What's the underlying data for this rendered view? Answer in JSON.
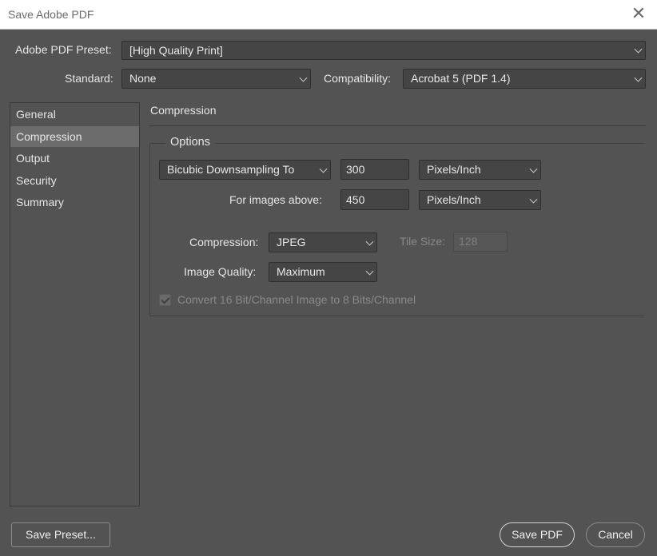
{
  "window": {
    "title": "Save Adobe PDF"
  },
  "preset": {
    "label": "Adobe PDF Preset:",
    "value": "[High Quality Print]"
  },
  "standard": {
    "label": "Standard:",
    "value": "None"
  },
  "compatibility": {
    "label": "Compatibility:",
    "value": "Acrobat 5 (PDF 1.4)"
  },
  "sidebar": {
    "items": [
      {
        "label": "General",
        "selected": false
      },
      {
        "label": "Compression",
        "selected": true
      },
      {
        "label": "Output",
        "selected": false
      },
      {
        "label": "Security",
        "selected": false
      },
      {
        "label": "Summary",
        "selected": false
      }
    ]
  },
  "panel": {
    "title": "Compression",
    "options": {
      "legend": "Options",
      "downsampling": {
        "method": "Bicubic Downsampling To",
        "value": "300",
        "unit": "Pixels/Inch"
      },
      "images_above": {
        "label": "For images above:",
        "value": "450",
        "unit": "Pixels/Inch"
      },
      "compression": {
        "label": "Compression:",
        "value": "JPEG"
      },
      "tile_size": {
        "label": "Tile Size:",
        "value": "128",
        "enabled": false
      },
      "image_quality": {
        "label": "Image Quality:",
        "value": "Maximum"
      },
      "convert_16bit": {
        "label": "Convert 16 Bit/Channel Image to 8 Bits/Channel",
        "checked": true,
        "enabled": false
      }
    }
  },
  "footer": {
    "save_preset": "Save Preset...",
    "save_pdf": "Save PDF",
    "cancel": "Cancel"
  }
}
